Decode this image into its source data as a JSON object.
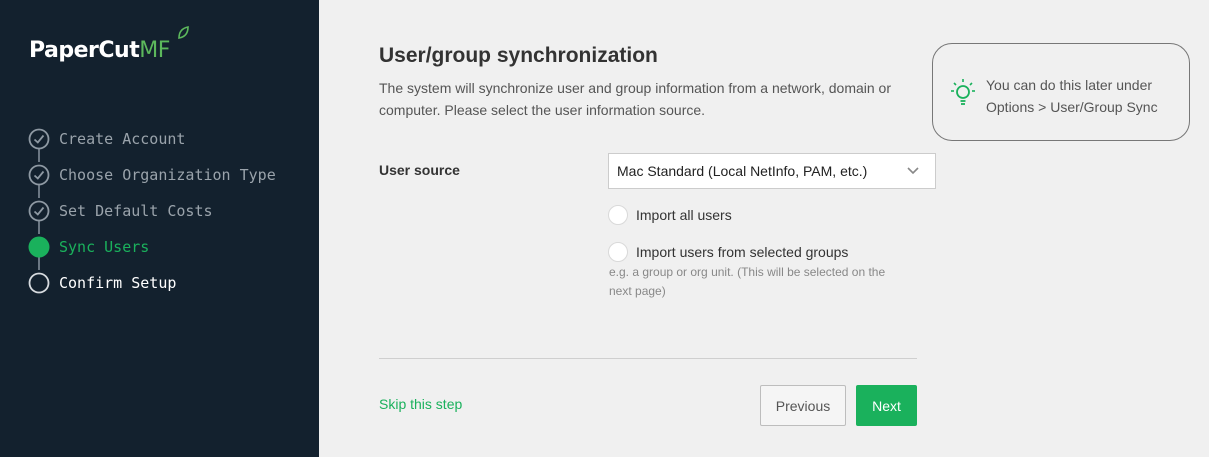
{
  "brand": {
    "name_main": "PaperCut",
    "name_suffix": "MF"
  },
  "steps": [
    {
      "label": "Create Account",
      "state": "done",
      "icon": "check-circle-icon"
    },
    {
      "label": "Choose Organization Type",
      "state": "done",
      "icon": "check-circle-icon"
    },
    {
      "label": "Set Default Costs",
      "state": "done",
      "icon": "check-circle-icon"
    },
    {
      "label": "Sync Users",
      "state": "active",
      "icon": "filled-circle-icon"
    },
    {
      "label": "Confirm Setup",
      "state": "pending",
      "icon": "empty-circle-icon"
    }
  ],
  "main": {
    "title": "User/group synchronization",
    "description": "The system will synchronize user and group information from a network, domain or computer. Please select the user information source.",
    "tip": "You can do this later under Options > User/Group Sync",
    "user_source": {
      "label": "User source",
      "selected": "Mac Standard (Local NetInfo, PAM, etc.)"
    },
    "options": {
      "import_all": "Import all users",
      "import_groups": "Import users from selected groups",
      "hint": "e.g. a group or org unit. (This will be selected on the next page)"
    },
    "actions": {
      "skip": "Skip this step",
      "previous": "Previous",
      "next": "Next"
    }
  },
  "colors": {
    "sidebar_bg": "#13212e",
    "accent": "#1ab15c",
    "page_bg": "#f0f0f0"
  }
}
